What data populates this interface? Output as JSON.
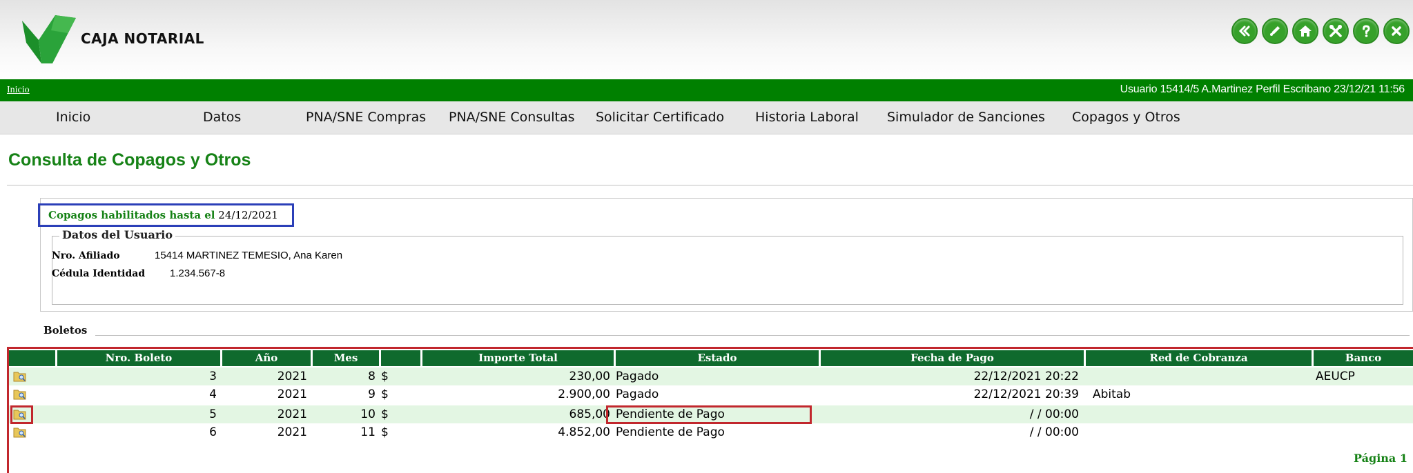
{
  "header": {
    "brand": "CAJA NOTARIAL",
    "icons": [
      "back-icon",
      "pen-icon",
      "home-icon",
      "tools-icon",
      "help-icon",
      "close-icon"
    ]
  },
  "breadcrumb": {
    "inicio": "Inicio"
  },
  "user_info": "Usuario 15414/5 A.Martinez Perfil Escribano 23/12/21 11:56",
  "menu": [
    "Inicio",
    "Datos",
    "PNA/SNE Compras",
    "PNA/SNE Consultas",
    "Solicitar Certificado",
    "Historia Laboral",
    "Simulador de Sanciones",
    "Copagos y Otros"
  ],
  "page_title": "Consulta de Copagos y Otros",
  "copagos": {
    "label": "Copagos habilitados hasta el",
    "date": "24/12/2021"
  },
  "datos_usuario": {
    "legend": "Datos del Usuario",
    "afiliado_label": "Nro. Afiliado",
    "afiliado_value": "15414 MARTINEZ TEMESIO, Ana Karen",
    "cedula_label": "Cédula Identidad",
    "cedula_value": "1.234.567-8"
  },
  "boletos": {
    "label": "Boletos",
    "columns": [
      "",
      "Nro. Boleto",
      "Año",
      "Mes",
      "",
      "Importe Total",
      "Estado",
      "Fecha de Pago",
      "Red de Cobranza",
      "Banco"
    ],
    "rows": [
      {
        "nro": "3",
        "anio": "2021",
        "mes": "8",
        "moneda": "$",
        "importe": "230,00",
        "estado": "Pagado",
        "fecha": "22/12/2021 20:22",
        "red": "",
        "banco": "AEUCP"
      },
      {
        "nro": "4",
        "anio": "2021",
        "mes": "9",
        "moneda": "$",
        "importe": "2.900,00",
        "estado": "Pagado",
        "fecha": "22/12/2021 20:39",
        "red": "Abitab",
        "banco": ""
      },
      {
        "nro": "5",
        "anio": "2021",
        "mes": "10",
        "moneda": "$",
        "importe": "685,00",
        "estado": "Pendiente de Pago",
        "fecha": "/ / 00:00",
        "red": "",
        "banco": ""
      },
      {
        "nro": "6",
        "anio": "2021",
        "mes": "11",
        "moneda": "$",
        "importe": "4.852,00",
        "estado": "Pendiente de Pago",
        "fecha": "/ / 00:00",
        "red": "",
        "banco": ""
      }
    ],
    "pagina_label": "Página",
    "pagina_num": "1"
  },
  "colors": {
    "brand_green": "#008000",
    "title_green": "#168216",
    "header_green": "#0f6a2d",
    "row_alt": "#e3f6e3",
    "highlight_red": "#c1272d",
    "highlight_blue": "#2b3fb8"
  }
}
